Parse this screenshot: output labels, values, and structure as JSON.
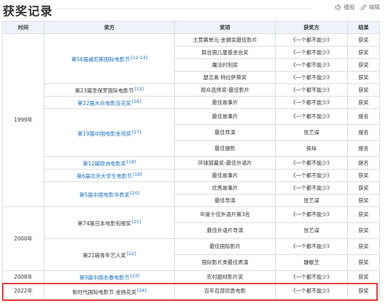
{
  "section": {
    "title": "获奖记录",
    "actions": [
      {
        "label": "播报",
        "icon": "speaker-icon"
      },
      {
        "label": "编辑",
        "icon": "pencil-icon"
      }
    ]
  },
  "table": {
    "headers": [
      "时间",
      "奖方",
      "奖项",
      "获奖方",
      "结果"
    ],
    "years": [
      "1999年",
      "2000年",
      "2008年",
      "2022年"
    ],
    "events": [
      {
        "name": "第56届威尼斯国际电影节",
        "ref": "[12-14]"
      },
      {
        "name": "第23届圣保罗国际电影节",
        "ref": "[15]"
      },
      {
        "name": "第22届大众电影百花奖",
        "ref": "[16]"
      },
      {
        "name": "第19届中国电影金鸡奖",
        "ref": "[17]"
      },
      {
        "name": "第12届欧洲电影奖",
        "ref": "[18]"
      },
      {
        "name": "第6届北京大学生电影节",
        "ref": "[19]"
      },
      {
        "name": "第5届中国电影华表奖",
        "ref": "[20]"
      },
      {
        "name": "第74届日本电影旬报奖",
        "ref": "[21]"
      },
      {
        "name": "第21届青年艺人奖",
        "ref": "[22]"
      },
      {
        "name": "第9届中国长春电影节",
        "ref": "[23]"
      },
      {
        "name": "新时代国际电影节·金扬花奖",
        "ref": "[26]"
      }
    ],
    "rows": [
      {
        "award": "主竞赛单元-金狮奖最佳影片",
        "winner": "《一个都不能少》",
        "result": "获奖"
      },
      {
        "award": "联合国儿童基金会奖",
        "winner": "《一个都不能少》",
        "result": "获奖"
      },
      {
        "award": "魔法时刻奖",
        "winner": "《一个都不能少》",
        "result": "获奖"
      },
      {
        "award": "瑟吉奥·特拉萨蒂奖",
        "winner": "《一个都不能少》",
        "result": "获奖"
      },
      {
        "award": "观众选择奖-最佳影片",
        "winner": "《一个都不能少》",
        "result": "获奖"
      },
      {
        "award": "最佳故事片",
        "winner": "《一个都不能少》",
        "result": "获奖"
      },
      {
        "award": "最佳故事片",
        "winner": "《一个都不能少》",
        "result": "提名"
      },
      {
        "award": "最佳导演",
        "winner": "张艺谋",
        "result": "提名"
      },
      {
        "award": "最佳摄影",
        "winner": "侯咏",
        "result": "提名"
      },
      {
        "award": "环球银幕奖-最佳外语片",
        "winner": "《一个都不能少》",
        "result": "提名"
      },
      {
        "award": "最佳故事片",
        "winner": "《一个都不能少》",
        "result": "获奖"
      },
      {
        "award": "优秀故事片",
        "winner": "《一个都不能少》",
        "result": "获奖"
      },
      {
        "award": "最佳导演",
        "winner": "张艺谋",
        "result": "获奖"
      },
      {
        "award": "年度十佳外语片第3名",
        "winner": "《一个都不能少》",
        "result": "获奖"
      },
      {
        "award": "最佳外语片导演",
        "winner": "张艺谋",
        "result": "获奖"
      },
      {
        "award": "最佳国际影片",
        "winner": "《一个都不能少》",
        "result": "获奖"
      },
      {
        "award": "国际影片类最佳表演",
        "winner": "魏敏芝",
        "result": "获奖"
      },
      {
        "award": "农村题材影片奖",
        "winner": "《一个都不能少》",
        "result": "获奖"
      },
      {
        "award": "百年百部优质电影",
        "winner": "《一个都不能少》",
        "result": "获奖"
      }
    ]
  }
}
